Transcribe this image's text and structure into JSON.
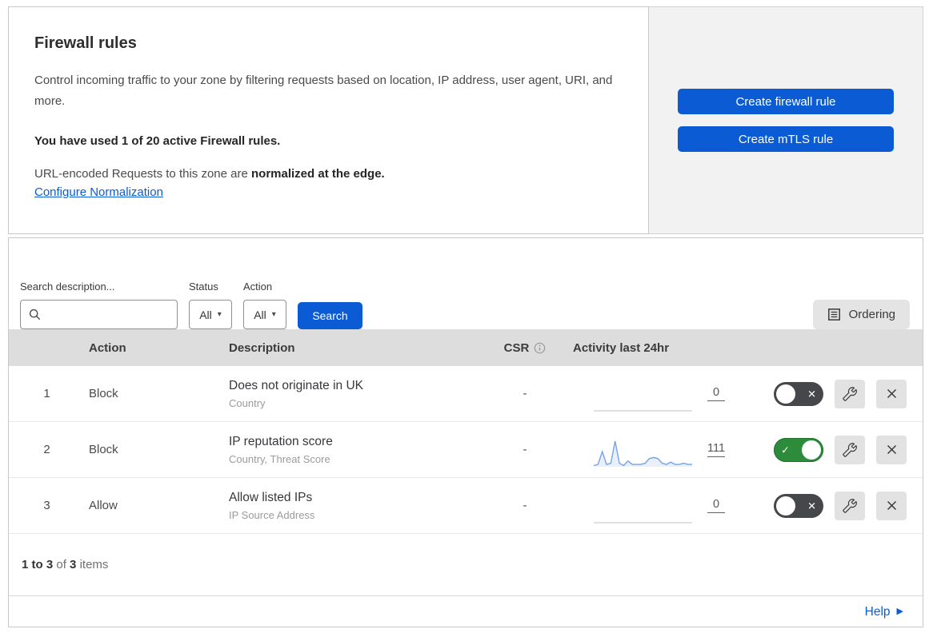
{
  "header": {
    "title": "Firewall rules",
    "description": "Control incoming traffic to your zone by filtering requests based on location, IP address, user agent, URI, and more.",
    "usage_summary": "You have used 1 of 20 active Firewall rules.",
    "normalization_prefix": "URL-encoded Requests to this zone are ",
    "normalization_bold": "normalized at the edge.",
    "normalization_link": "Configure Normalization"
  },
  "actions_panel": {
    "create_firewall_rule": "Create firewall rule",
    "create_mtls_rule": "Create mTLS rule"
  },
  "filters": {
    "search_label": "Search description...",
    "search_value": "",
    "search_placeholder": "",
    "status_label": "Status",
    "status_value": "All",
    "action_label": "Action",
    "action_value": "All",
    "search_button": "Search",
    "ordering_button": "Ordering"
  },
  "table": {
    "columns": {
      "action": "Action",
      "description": "Description",
      "csr": "CSR",
      "activity": "Activity last 24hr"
    },
    "rows": [
      {
        "index": "1",
        "action": "Block",
        "description": "Does not originate in UK",
        "fields": "Country",
        "csr": "-",
        "count": "0",
        "enabled": false,
        "sparkline": []
      },
      {
        "index": "2",
        "action": "Block",
        "description": "IP reputation score",
        "fields": "Country, Threat Score",
        "csr": "-",
        "count": "111",
        "enabled": true,
        "sparkline": [
          1,
          2,
          13,
          2,
          3,
          22,
          3,
          1,
          5,
          2,
          2,
          2,
          3,
          7,
          8,
          7,
          3,
          2,
          4,
          2,
          2,
          3,
          2,
          2
        ]
      },
      {
        "index": "3",
        "action": "Allow",
        "description": "Allow listed IPs",
        "fields": "IP Source Address",
        "csr": "-",
        "count": "0",
        "enabled": false,
        "sparkline": []
      }
    ]
  },
  "footer": {
    "range": "1 to 3",
    "of_label": "of",
    "total": "3",
    "items_label": "items",
    "help": "Help"
  },
  "icons": {
    "check": "✓",
    "close": "✕",
    "dropdown_caret": "▾",
    "help_arrow": "▶"
  },
  "colors": {
    "primary_blue": "#0a5bd4",
    "link_blue": "#0b5bd3",
    "toggle_on_green": "#2d8c3c",
    "toggle_off_gray": "#46474b",
    "sparkline_blue": "#74a3e6",
    "table_header_gray": "#dddddd",
    "panel_gray": "#f2f2f2"
  }
}
